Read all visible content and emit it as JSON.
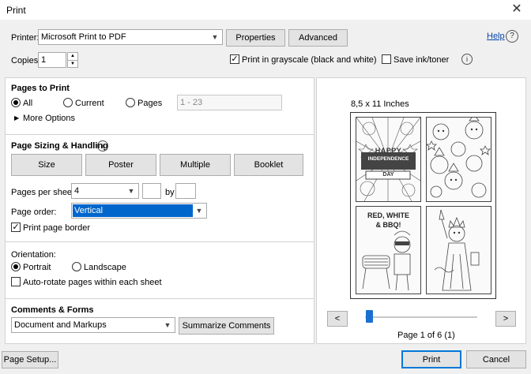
{
  "window": {
    "title": "Print"
  },
  "header": {
    "printer_label": "Printer:",
    "printer_value": "Microsoft Print to PDF",
    "properties_label": "Properties",
    "advanced_label": "Advanced",
    "help_label": "Help",
    "copies_label": "Copies:",
    "copies_value": "1",
    "grayscale_label": "Print in grayscale (black and white)",
    "grayscale_checked": true,
    "save_ink_label": "Save ink/toner",
    "save_ink_checked": false
  },
  "pages_to_print": {
    "title": "Pages to Print",
    "all_label": "All",
    "current_label": "Current",
    "pages_label": "Pages",
    "pages_range_placeholder": "1 - 23",
    "more_options_label": "More Options",
    "selected": "All"
  },
  "page_sizing": {
    "title": "Page Sizing & Handling",
    "tabs": [
      "Size",
      "Poster",
      "Multiple",
      "Booklet"
    ],
    "pages_per_sheet_label": "Pages per sheet:",
    "pages_per_sheet_value": "4",
    "by_label": "by",
    "page_order_label": "Page order:",
    "page_order_value": "Vertical",
    "print_border_label": "Print page border",
    "print_border_checked": true
  },
  "orientation": {
    "title": "Orientation:",
    "portrait_label": "Portrait",
    "landscape_label": "Landscape",
    "selected": "Portrait",
    "auto_rotate_label": "Auto-rotate pages within each sheet",
    "auto_rotate_checked": false
  },
  "comments_forms": {
    "title": "Comments & Forms",
    "value": "Document and Markups",
    "summarize_label": "Summarize Comments"
  },
  "preview": {
    "paper_size": "8,5 x 11 Inches",
    "page_info": "Page 1 of 6 (1)",
    "prev_label": "<",
    "next_label": ">",
    "slider_position": 0.0,
    "thumb_texts": {
      "happy": "HAPPY",
      "independence": "INDEPENDENCE",
      "day": "DAY",
      "red_white": "RED, WHITE",
      "bbq": "& BBQ!"
    }
  },
  "footer": {
    "page_setup_label": "Page Setup...",
    "print_label": "Print",
    "cancel_label": "Cancel"
  }
}
